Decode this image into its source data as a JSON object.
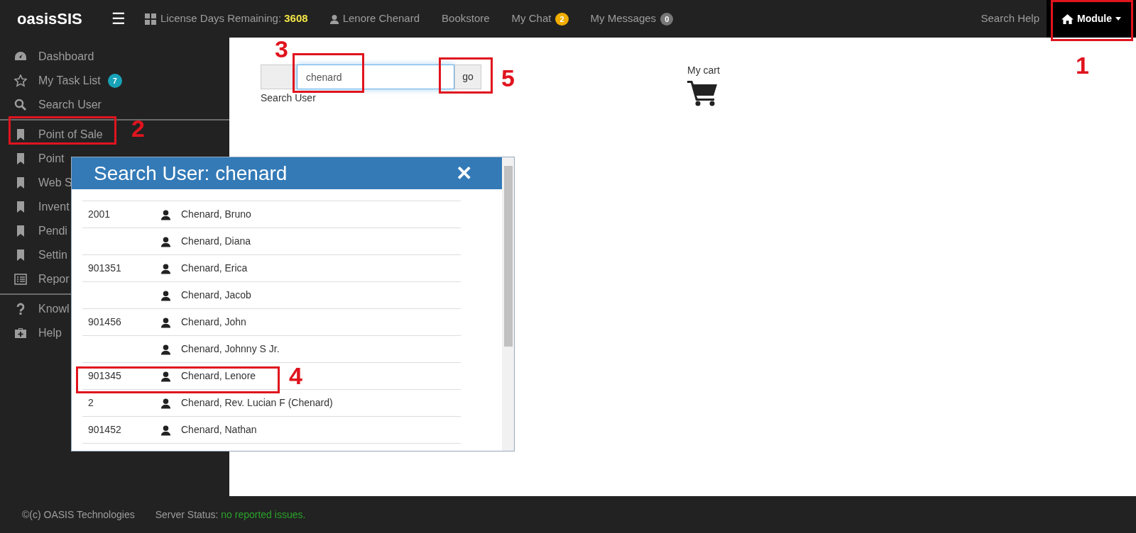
{
  "navbar": {
    "logo": "oasisSIS",
    "menu_icon": "☰",
    "license_label": "License Days Remaining:",
    "license_days": "3608",
    "user": "Lenore Chenard",
    "links": [
      {
        "label": "Bookstore"
      },
      {
        "label": "My Chat",
        "badge": "2",
        "color": "#f0ad00"
      },
      {
        "label": "My Messages",
        "badge": "0",
        "color": "#777777"
      }
    ],
    "search_help": "Search Help",
    "module": "Module"
  },
  "sidebar": {
    "sections": [
      {
        "items": [
          {
            "kind": "gauge",
            "label": "Dashboard"
          },
          {
            "kind": "star",
            "label": "My Task List",
            "badge": "7"
          },
          {
            "kind": "search",
            "label": "Search User"
          }
        ]
      },
      {
        "items": [
          {
            "kind": "bookmark",
            "label": "Point of Sale"
          },
          {
            "kind": "bookmark",
            "label": "Point"
          },
          {
            "kind": "bookmark",
            "label": "Web S"
          },
          {
            "kind": "bookmark",
            "label": "Invent"
          },
          {
            "kind": "bookmark",
            "label": "Pendi"
          },
          {
            "kind": "bookmark",
            "label": "Settin"
          },
          {
            "kind": "list",
            "label": "Repor"
          }
        ]
      },
      {
        "items": [
          {
            "kind": "question",
            "label": "Knowl"
          },
          {
            "kind": "medkit",
            "label": "Help"
          }
        ]
      }
    ]
  },
  "search": {
    "value": "chenard",
    "button": "go",
    "label": "Search User"
  },
  "cart": {
    "label": "My cart"
  },
  "dialog": {
    "title": "Search User: chenard",
    "close": "✕",
    "rows": [
      {
        "id": "2001",
        "name": "Chenard, Bruno"
      },
      {
        "name": "Chenard, Diana"
      },
      {
        "id": "901351",
        "name": "Chenard, Erica"
      },
      {
        "name": "Chenard, Jacob"
      },
      {
        "id": "901456",
        "name": "Chenard, John"
      },
      {
        "name": "Chenard, Johnny S Jr."
      },
      {
        "id": "901345",
        "name": "Chenard, Lenore"
      },
      {
        "id": "2",
        "name": "Chenard, Rev. Lucian F (Chenard)"
      },
      {
        "id": "901452",
        "name": "Chenard, Nathan"
      }
    ]
  },
  "annotations": [
    {
      "label": "1"
    },
    {
      "label": "2"
    },
    {
      "label": "3"
    },
    {
      "label": "4"
    },
    {
      "label": "5"
    }
  ],
  "footer": {
    "copyright": "©(c) OASIS Technologies",
    "status_label": "Server Status:",
    "status": "no reported issues."
  }
}
